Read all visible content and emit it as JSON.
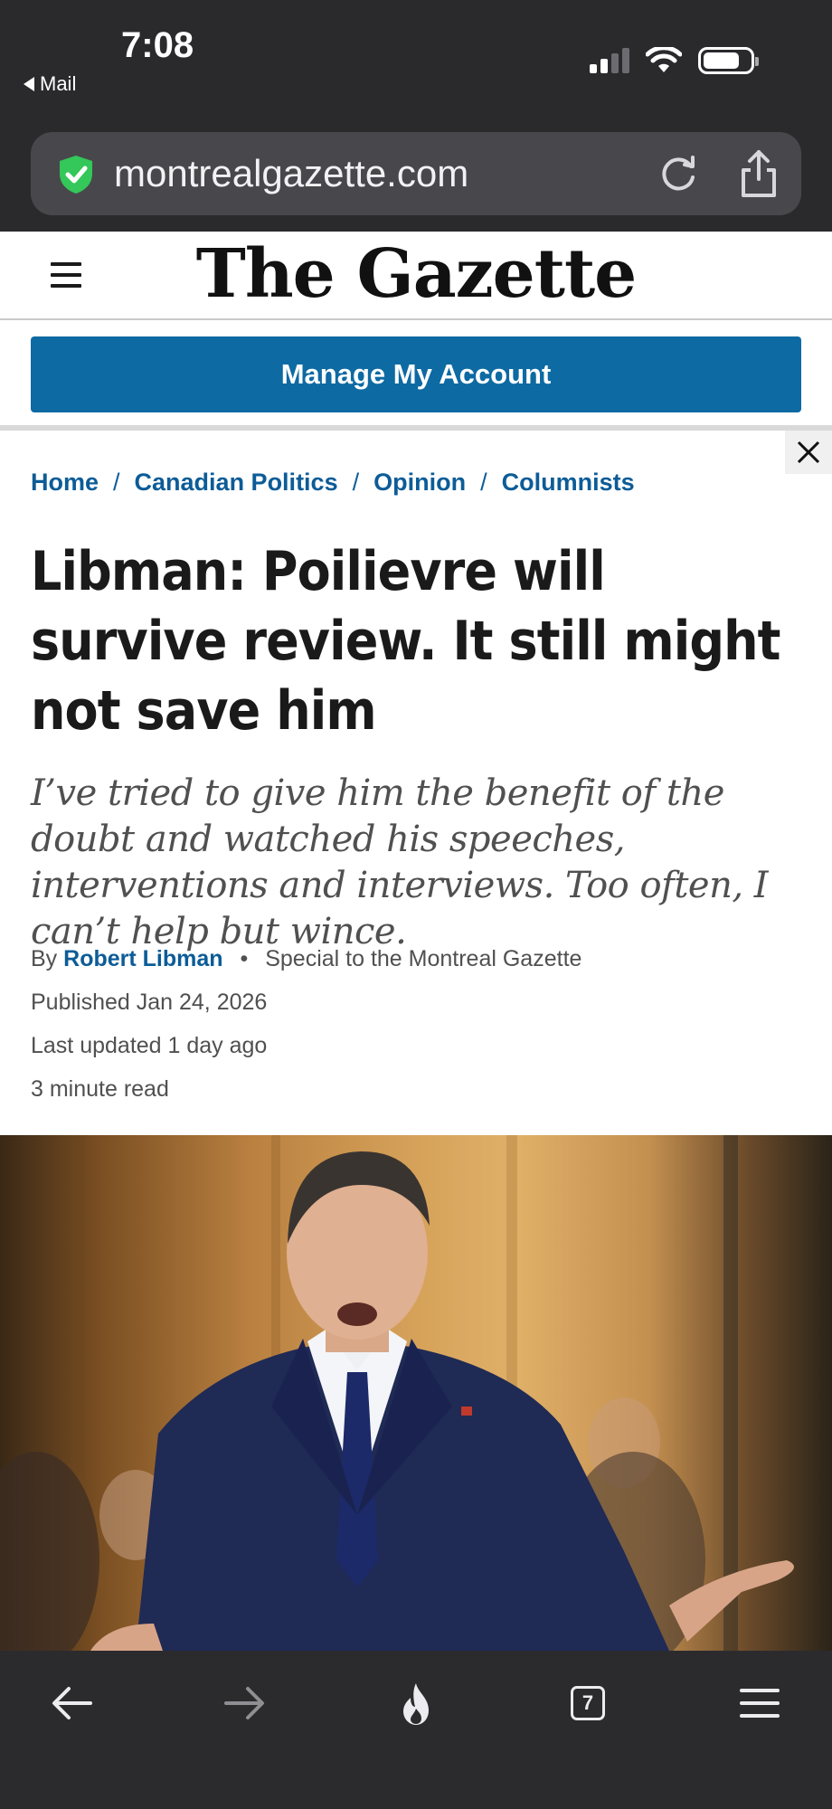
{
  "status_bar": {
    "time": "7:08",
    "back_app": "Mail"
  },
  "browser": {
    "url": "montrealgazette.com",
    "tab_count": "7"
  },
  "site": {
    "logo": "The Gazette",
    "account_button": "Manage My Account"
  },
  "breadcrumb": [
    "Home",
    "Canadian Politics",
    "Opinion",
    "Columnists"
  ],
  "article": {
    "headline": "Libman: Poilievre will survive review. It still might not save him",
    "dek": "I’ve tried to give him the benefit of the doubt and watched his speeches, interventions and interviews. Too often, I can’t help but wince.",
    "by_prefix": "By",
    "author": "Robert Libman",
    "author_role": "Special to the Montreal Gazette",
    "published": "Published Jan 24, 2026",
    "updated": "Last updated 1 day ago",
    "read_time": "3 minute read"
  },
  "colors": {
    "chrome_dark": "#2a2a2d",
    "link_blue": "#0c5c97",
    "button_blue": "#0d6aa3",
    "shield_green": "#34c759"
  },
  "icons": {
    "nav": [
      "back-arrow-icon",
      "forward-arrow-icon",
      "flame-icon",
      "tabs-icon",
      "menu-icon"
    ]
  }
}
